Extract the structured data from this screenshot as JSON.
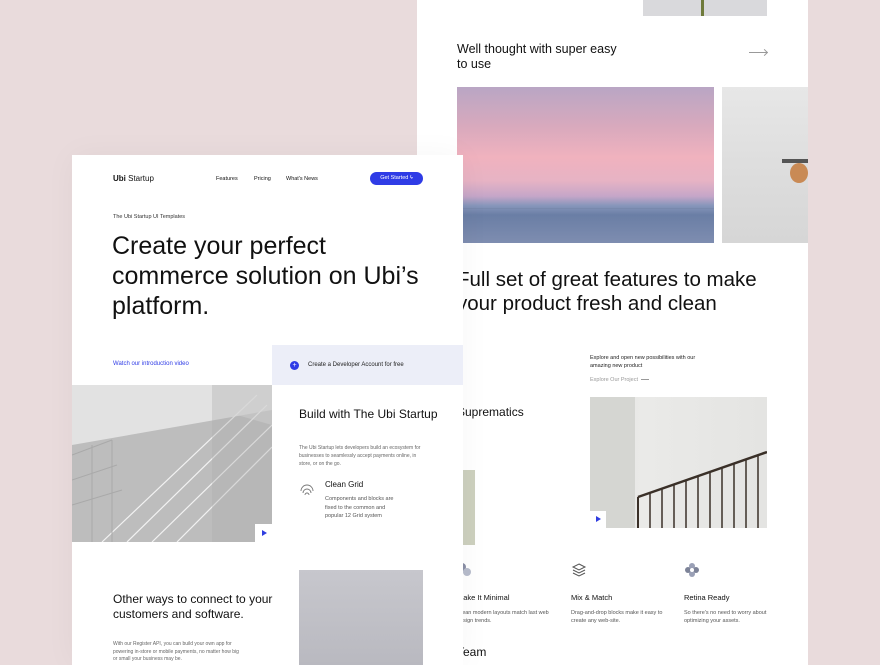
{
  "back": {
    "tagline": "Well thought with super easy to use",
    "headline": "Full set of great features to make your product fresh and clean",
    "explore_text": "Explore and open new possibilities with our amazing new product",
    "explore_link": "Explore Our Project",
    "suprematics": "Suprematics",
    "team": "Team",
    "features": [
      {
        "title": "Make It Minimal",
        "desc": "Clean modern layouts match last web design trends.",
        "icon": "cubes-icon"
      },
      {
        "title": "Mix & Match",
        "desc": "Drag-and-drop blocks make it easy to create any web-site.",
        "icon": "layers-icon"
      },
      {
        "title": "Retina Ready",
        "desc": "So there's no need to worry about optimizing your assets.",
        "icon": "flower-icon"
      }
    ]
  },
  "front": {
    "logo_bold": "Ubi",
    "logo_rest": " Startup",
    "nav": [
      "Features",
      "Pricing",
      "What's News"
    ],
    "cta": "Get Started",
    "eyebrow": "The Ubi Startup UI Templates",
    "hero": "Create your perfect commerce solution on Ubi’s platform.",
    "watch": "Watch our introduction video",
    "dev_account": "Create a Developer Account for free",
    "build_title": "Build with The Ubi Startup",
    "build_desc": "The Ubi Startup lets developers build an ecosystem for businesses to seamlessly accept payments online, in store, or on the go.",
    "clean_grid": "Clean Grid",
    "clean_grid_desc": "Components and blocks are fixed to the common and popular 12 Grid system",
    "other_title": "Other ways to connect to your customers and software.",
    "other_desc": "With our Register API, you can build your own app for powering in-store or mobile payments, no matter how big or small your business may be."
  },
  "colors": {
    "background": "#e9dbdc",
    "accent": "#2f3ce6",
    "dev_box": "#eceef8"
  }
}
